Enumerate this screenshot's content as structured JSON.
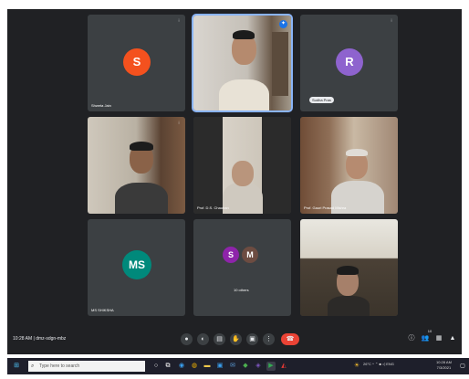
{
  "participants": [
    {
      "name": "Shweta Jain",
      "avatar_letter": "S",
      "avatar_color": "#f4511e"
    },
    {
      "name": "",
      "pinned": true
    },
    {
      "name": "Sudha Pras",
      "avatar_letter": "R",
      "avatar_color": "#8e63ce"
    },
    {
      "name": "",
      "video": true
    },
    {
      "name": "Prof. D.S. Chauhan",
      "video": true
    },
    {
      "name": "Prof. Gauri Prasad Mishra",
      "video": true
    },
    {
      "name": "MS SHIKSHA",
      "avatar_letter": "MS",
      "avatar_color": "#00897b"
    },
    {
      "name": "10 others",
      "avatar_letters": [
        "S",
        "M"
      ],
      "avatar_colors": [
        "#8e24aa",
        "#6d4c41"
      ]
    },
    {
      "name": "",
      "video": true
    }
  ],
  "meeting": {
    "time": "10:28 AM",
    "separator": "|",
    "code": "dmz-sdgn-mbz"
  },
  "controls": {
    "icons": [
      "mic-icon",
      "camera-icon",
      "captions-icon",
      "raise-hand-icon",
      "present-icon",
      "more-icon",
      "end-call-icon"
    ],
    "glyphs": [
      "●",
      "◐",
      "▤",
      "✋",
      "▣",
      "⋮",
      "☎"
    ]
  },
  "right_controls": {
    "icons": [
      "info-icon",
      "people-icon",
      "chat-icon",
      "activities-icon"
    ],
    "glyphs": [
      "ⓘ",
      "👥",
      "▦",
      "▲"
    ],
    "people_count": "10"
  },
  "taskbar": {
    "search_placeholder": "Type here to search",
    "tray_text": "26°C  ^ ⌃ ■ ◁ ENG",
    "clock_time": "10:28 AM",
    "clock_date": "7/3/2021"
  },
  "colors": {
    "background": "#202124",
    "tile": "#3c4043",
    "end_call": "#ea4335",
    "accent": "#8ab4f8"
  }
}
